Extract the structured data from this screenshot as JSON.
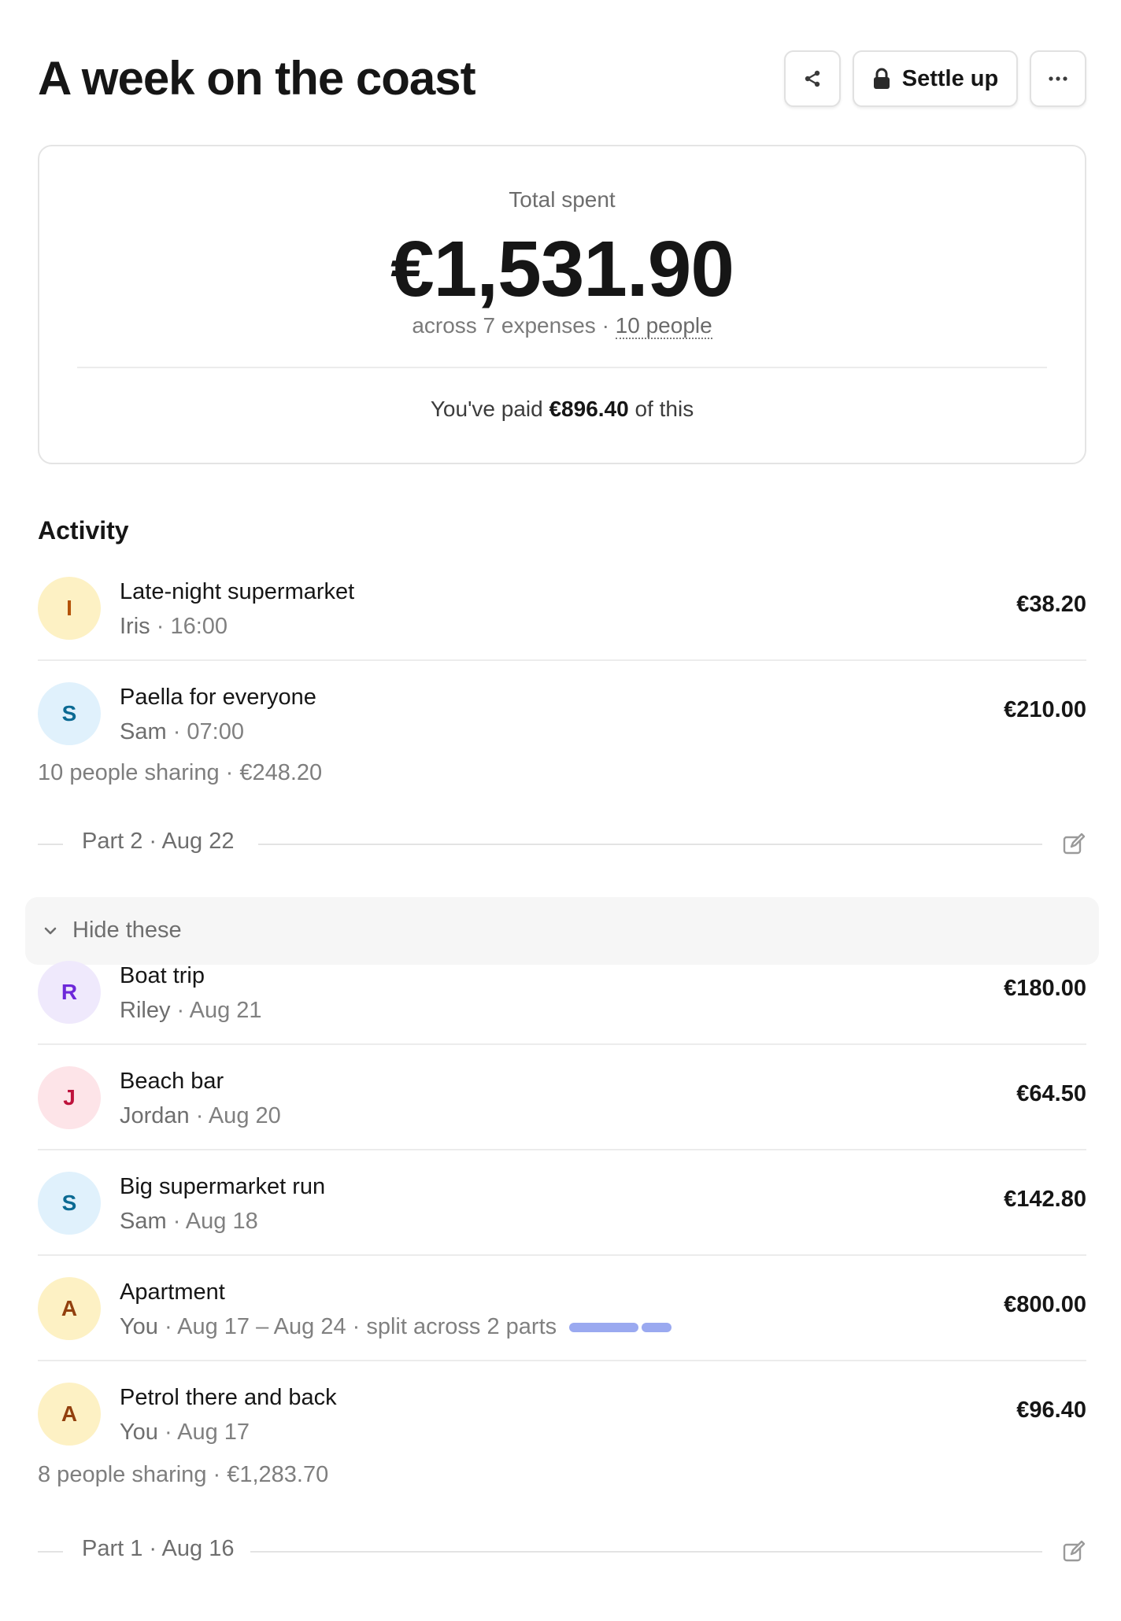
{
  "header": {
    "title": "A week on the coast",
    "settle_label": "Settle up"
  },
  "summary": {
    "label": "Total spent",
    "total": "€1,531.90",
    "expenses": "across 7 expenses",
    "separator": "·",
    "people": "10 people",
    "paid_prefix": "You've paid",
    "paid_amount": "€896.40",
    "paid_suffix": "of this"
  },
  "activity": {
    "title": "Activity",
    "hide_label": "Hide these",
    "part2": {
      "label": "Part 2 · Aug 22"
    },
    "part1": {
      "label": "Part 1 · Aug 16"
    },
    "sharing_1": "10 people sharing · €248.20",
    "sharing_2": "8 people sharing · €1,283.70",
    "items": [
      {
        "title": "Late-night supermarket",
        "who": "Iris",
        "when": " · 16:00",
        "amount": "€38.20",
        "initial": "I",
        "avatar_bg": "#fdf1c4",
        "avatar_fg": "#b45309"
      },
      {
        "title": "Paella for everyone",
        "who": "Sam",
        "when": " · 07:00",
        "amount": "€210.00",
        "initial": "S",
        "avatar_bg": "#e0f1fc",
        "avatar_fg": "#0b6a93"
      },
      {
        "title": "Boat trip",
        "who": "Riley",
        "when": " · Aug 21",
        "amount": "€180.00",
        "initial": "R",
        "avatar_bg": "#efe9fc",
        "avatar_fg": "#6d28d9"
      },
      {
        "title": "Beach bar",
        "who": "Jordan",
        "when": " · Aug 20",
        "amount": "€64.50",
        "initial": "J",
        "avatar_bg": "#fde4e8",
        "avatar_fg": "#be123c"
      },
      {
        "title": "Big supermarket run",
        "who": "Sam",
        "when": " · Aug 18",
        "amount": "€142.80",
        "initial": "S",
        "avatar_bg": "#e0f1fc",
        "avatar_fg": "#0b6a93"
      },
      {
        "title": "Apartment",
        "who": "You",
        "when": " · Aug 17 – Aug 24",
        "extra": " · split across 2 parts",
        "amount": "€800.00",
        "initial": "A",
        "avatar_bg": "#fdf1c4",
        "avatar_fg": "#92400e"
      },
      {
        "title": "Petrol there and back",
        "who": "You",
        "when": " · Aug 17",
        "amount": "€96.40",
        "initial": "A",
        "avatar_bg": "#fdf1c4",
        "avatar_fg": "#92400e"
      }
    ]
  },
  "colors": {
    "split_bar": "#9aa9f0",
    "text_primary": "#161616",
    "text_muted": "#7e7e7e"
  },
  "icons": [
    "share-icon",
    "lock-icon",
    "more-icon",
    "edit-icon",
    "chevron-down-icon"
  ]
}
